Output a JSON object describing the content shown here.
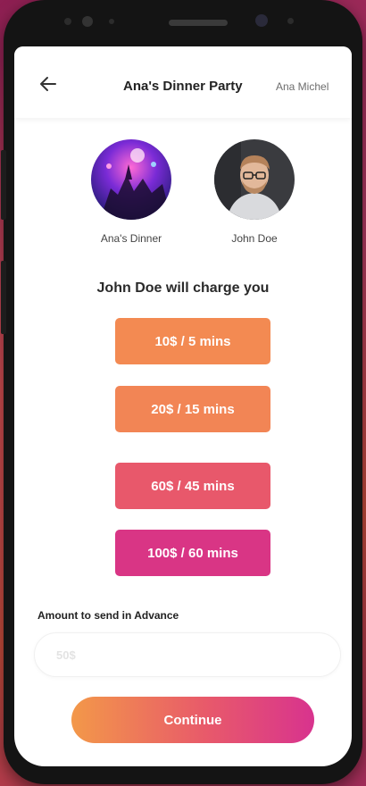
{
  "header": {
    "title": "Ana's Dinner Party",
    "user": "Ana Michel",
    "back_icon": "arrow-left-icon"
  },
  "participants": [
    {
      "label": "Ana's Dinner",
      "image": "party-crowd-photo"
    },
    {
      "label": "John Doe",
      "image": "man-with-glasses-photo"
    }
  ],
  "charge_text": "John Doe will charge you",
  "rates": [
    {
      "label": "10$ / 5 mins",
      "color": "#f38a52"
    },
    {
      "label": "20$ / 15 mins",
      "color": "#f28555"
    },
    {
      "label": "60$ / 45 mins",
      "color": "#e8586b"
    },
    {
      "label": "100$ / 60 mins",
      "color": "#d93585"
    }
  ],
  "advance": {
    "label": "Amount to send in Advance",
    "placeholder": "50$"
  },
  "continue_label": "Continue",
  "colors": {
    "accent_start": "#f39849",
    "accent_end": "#d8338e"
  }
}
